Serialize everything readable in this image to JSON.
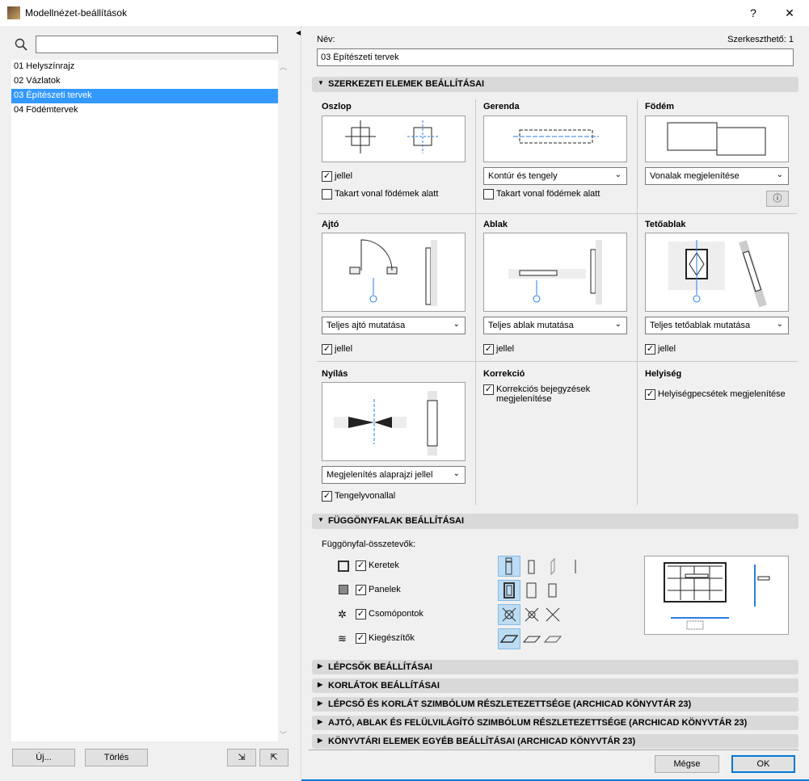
{
  "window": {
    "title": "Modellnézet-beállítások",
    "help": "?",
    "close": "✕"
  },
  "left": {
    "search_value": "",
    "items": [
      {
        "label": "01 Helyszínrajz"
      },
      {
        "label": "02 Vázlatok"
      },
      {
        "label": "03 Építészeti tervek",
        "selected": true
      },
      {
        "label": "04 Födémtervek"
      }
    ],
    "new_label": "Új...",
    "delete_label": "Törlés"
  },
  "right": {
    "name_label": "Név:",
    "editable": "Szerkeszthető: 1",
    "name_value": "03 Építészeti tervek",
    "struct": {
      "header": "SZERKEZETI ELEMEK BEÁLLÍTÁSAI",
      "column": {
        "title": "Oszlop",
        "cb1": "jellel",
        "cb2": "Takart vonal födémek alatt"
      },
      "beam": {
        "title": "Gerenda",
        "dropdown": "Kontúr és tengely",
        "cb": "Takart vonal födémek alatt"
      },
      "slab": {
        "title": "Födém",
        "dropdown": "Vonalak megjelenítése"
      },
      "door": {
        "title": "Ajtó",
        "dropdown": "Teljes ajtó mutatása",
        "cb": "jellel"
      },
      "window": {
        "title": "Ablak",
        "dropdown": "Teljes ablak mutatása",
        "cb": "jellel"
      },
      "skylight": {
        "title": "Tetőablak",
        "dropdown": "Teljes tetőablak mutatása",
        "cb": "jellel"
      },
      "opening": {
        "title": "Nyílás",
        "dropdown": "Megjelenítés alaprajzi jellel",
        "cb": "Tengelyvonallal"
      },
      "correction": {
        "title": "Korrekció",
        "cb": "Korrekciós bejegyzések megjelenítése"
      },
      "zone": {
        "title": "Helyiség",
        "cb": "Helyiségpecsétek megjelenítése"
      }
    },
    "curtain": {
      "header": "FÜGGÖNYFALAK BEÁLLÍTÁSAI",
      "label": "Függönyfal-összetevők:",
      "rows": [
        {
          "label": "Keretek"
        },
        {
          "label": "Panelek"
        },
        {
          "label": "Csomópontok"
        },
        {
          "label": "Kiegészítők"
        }
      ]
    },
    "collapsed": [
      {
        "label": "LÉPCSŐK BEÁLLÍTÁSAI"
      },
      {
        "label": "KORLÁTOK BEÁLLÍTÁSAI"
      },
      {
        "label": "LÉPCSŐ ÉS KORLÁT SZIMBÓLUM RÉSZLETEZETTSÉGE (ARCHICAD KÖNYVTÁR 23)"
      },
      {
        "label": "AJTÓ, ABLAK ÉS FELÜLVILÁGÍTÓ SZIMBÓLUM RÉSZLETEZETTSÉGE (ARCHICAD KÖNYVTÁR 23)"
      },
      {
        "label": "KÖNYVTÁRI ELEMEK EGYÉB BEÁLLÍTÁSAI (ARCHICAD KÖNYVTÁR 23)"
      }
    ],
    "cancel_label": "Mégse",
    "ok_label": "OK"
  },
  "colors": {
    "accent": "#3399ff",
    "ok_border": "#0078d7",
    "selected_tool": "#bcdcf4"
  }
}
